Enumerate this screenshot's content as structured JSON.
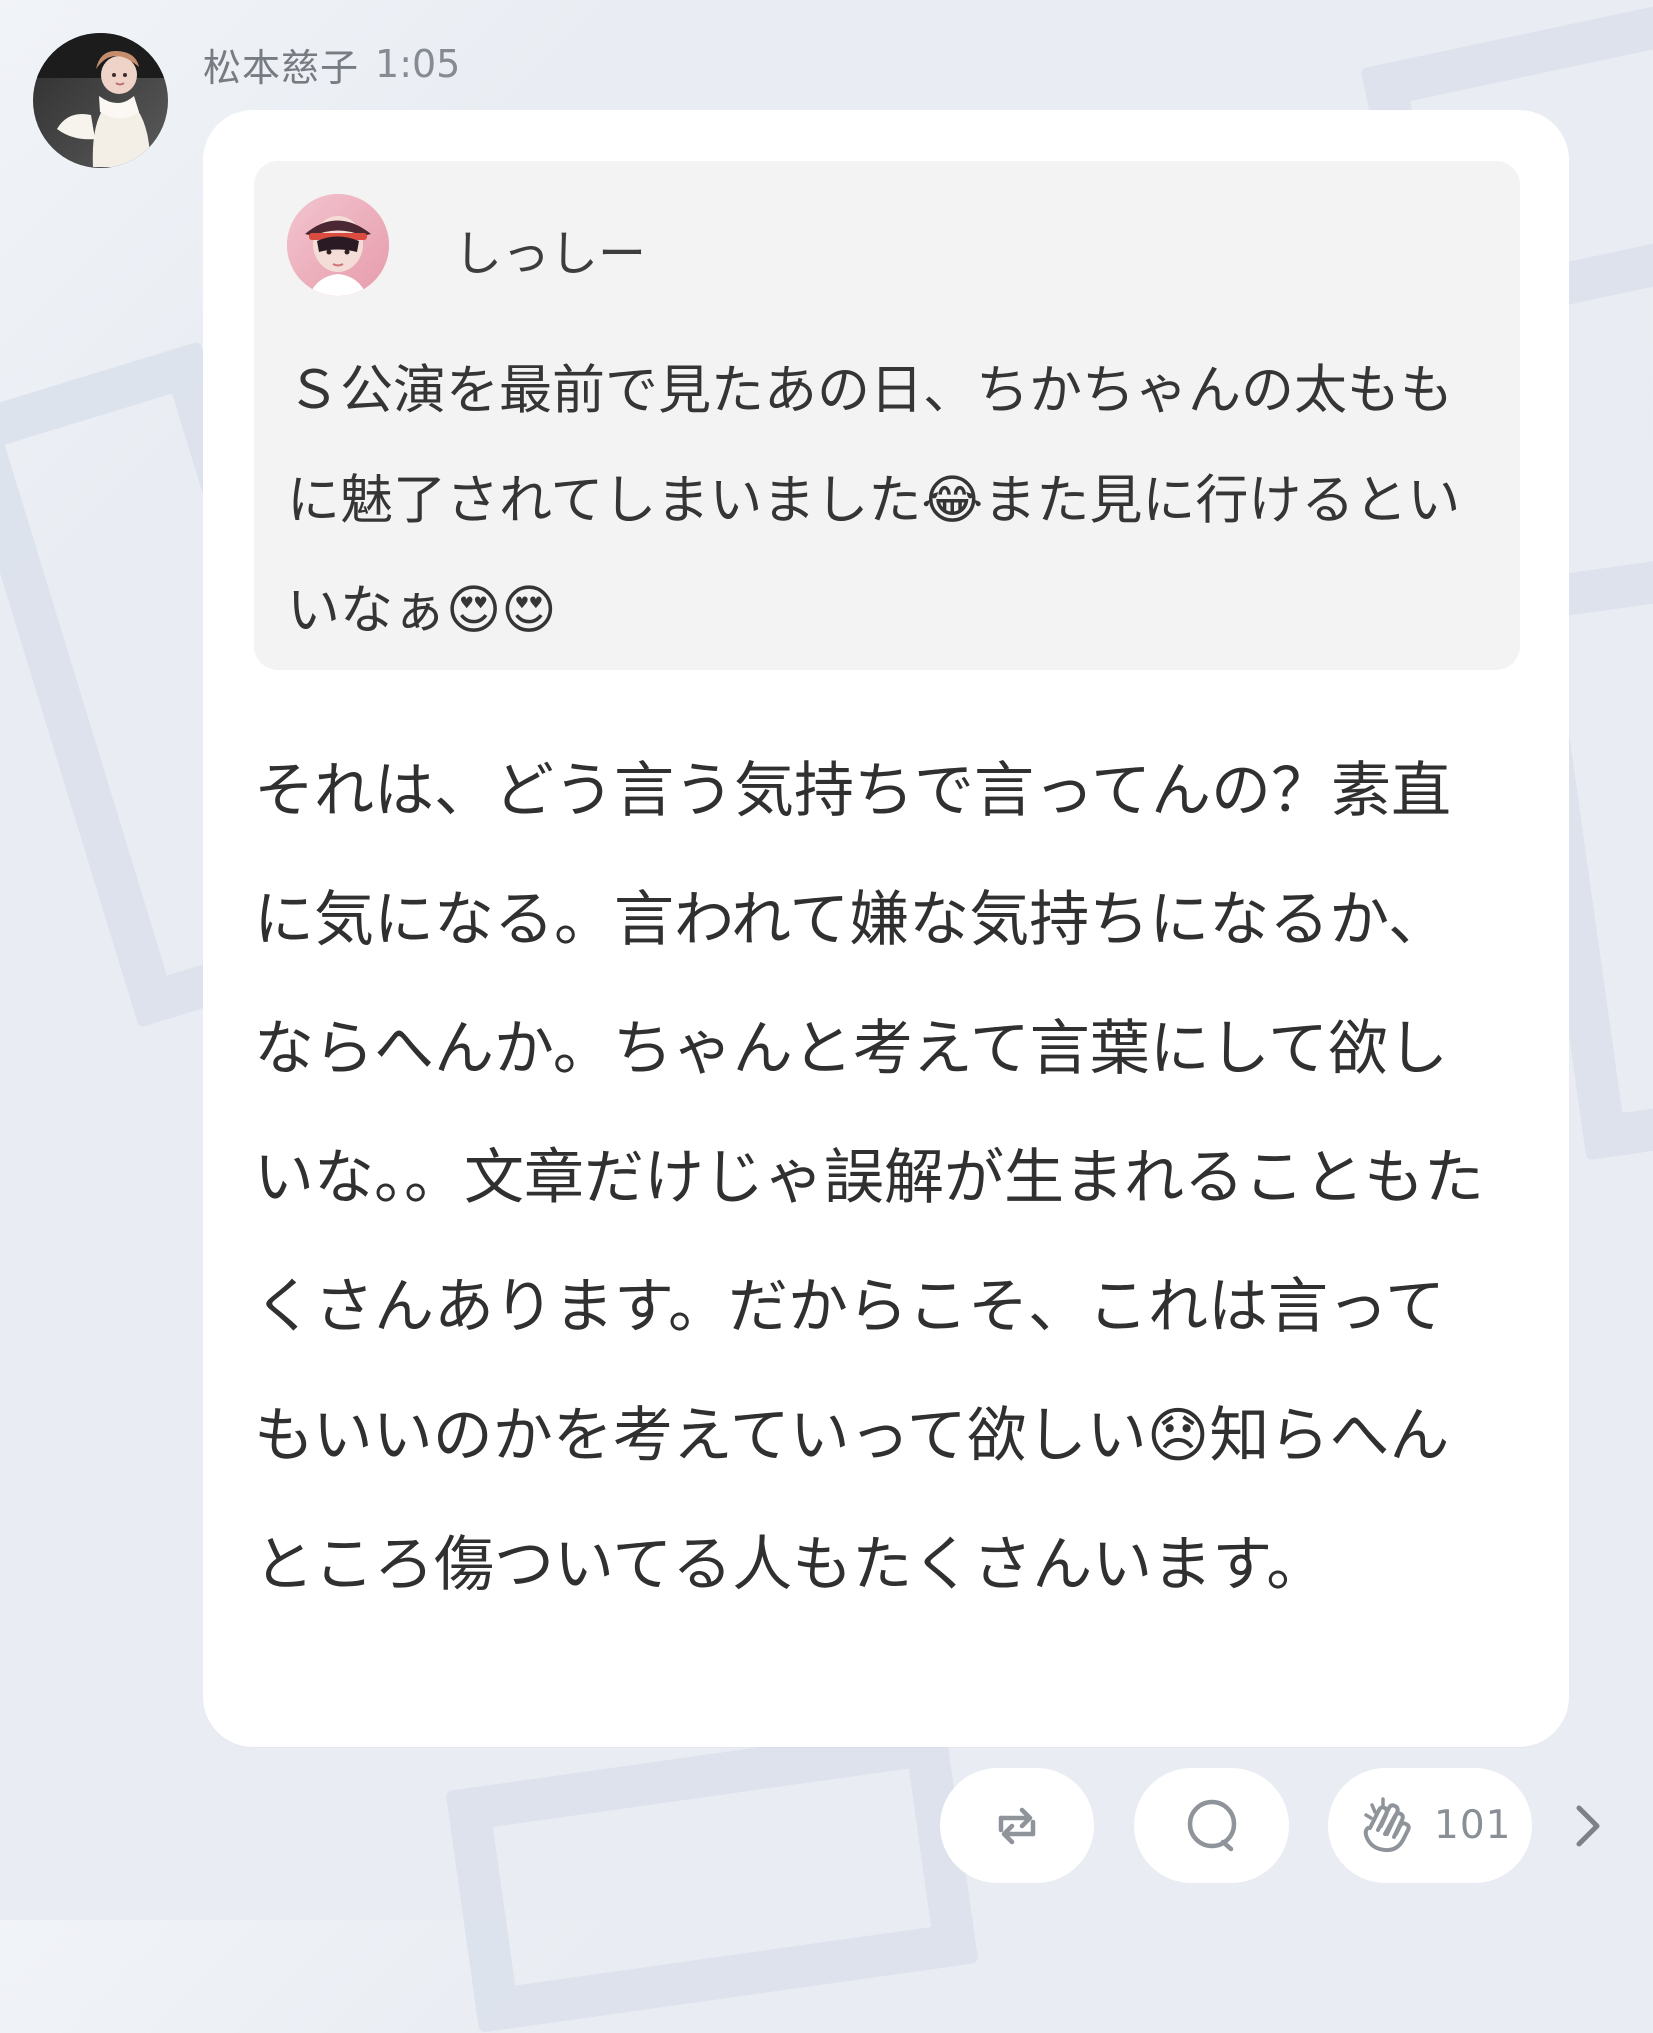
{
  "post": {
    "author_name": "松本慈子",
    "time": "1:05",
    "quoted_post": {
      "author_name": "しっしー",
      "text": "Ｓ公演を最前で見たあの日、ちかちゃんの太ももに魅了されてしまいました😂また見に行けるといいなぁ😍😍"
    },
    "reply_text": "それは、どう言う気持ちで言ってんの？素直に気になる。言われて嫌な気持ちになるか、ならへんか。ちゃんと考えて言葉にして欲しいな。。文章だけじゃ誤解が生まれることもたくさんあります。だからこそ、これは言ってもいいのかを考えていって欲しい😞知らへんところ傷ついてる人もたくさんいます。"
  },
  "actions": {
    "repost_icon": "repost-icon",
    "comment_icon": "comment-icon",
    "clap_icon": "clap-icon",
    "clap_count": "101",
    "next_icon": "chevron-right-icon"
  },
  "colors": {
    "background": "#e9edf3",
    "card": "#ffffff",
    "quote_background": "#f3f3f3",
    "muted_text": "#777b82",
    "icon": "#8f949b"
  }
}
